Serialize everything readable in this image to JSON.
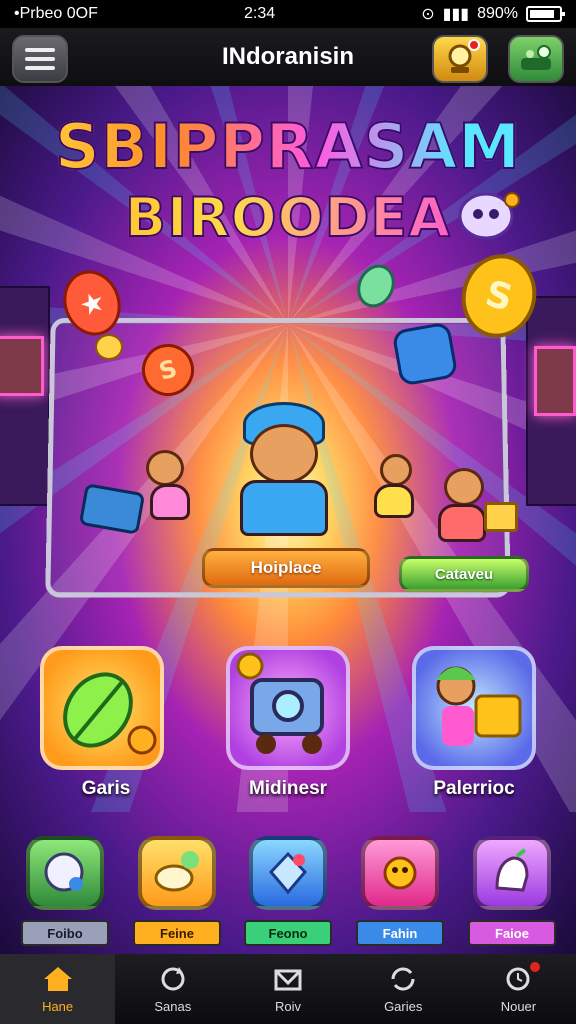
{
  "status_bar": {
    "left": "•Prbeo 0OF",
    "time": "2:34",
    "battery_text": "890%"
  },
  "app_bar": {
    "title": "INdoranisin"
  },
  "logo": {
    "line1": "SBIPPRASAM",
    "line2": "BIROODEA"
  },
  "coins": {
    "red_coin_symbol": "S",
    "gold_coin_symbol": "S"
  },
  "hero_buttons": {
    "primary": "Hoiplace",
    "secondary": "Cataveu"
  },
  "features": [
    {
      "label": "Garis",
      "icon": "leaf-icon"
    },
    {
      "label": "Midinesr",
      "icon": "robot-cart-icon"
    },
    {
      "label": "Palerrioc",
      "icon": "character-box-icon"
    }
  ],
  "quick_actions": [
    {
      "label": "Foibo",
      "icon": "gem-icon",
      "color": "#4cb84a",
      "label_bg": "#9aa0b8"
    },
    {
      "label": "Feine",
      "icon": "shoe-icon",
      "color": "#ffb020",
      "label_bg": "#ffb020"
    },
    {
      "label": "Feono",
      "icon": "crystal-icon",
      "color": "#3aa0e8",
      "label_bg": "#3ad07a"
    },
    {
      "label": "Fahin",
      "icon": "star-creature-icon",
      "color": "#ff4aa8",
      "label_bg": "#3a8ae8"
    },
    {
      "label": "Faioe",
      "icon": "glove-icon",
      "color": "#c860e8",
      "label_bg": "#d85ae0"
    }
  ],
  "bottom_nav": [
    {
      "label": "Hane",
      "icon": "home-icon",
      "active": true
    },
    {
      "label": "Sanas",
      "icon": "refresh-icon",
      "active": false
    },
    {
      "label": "Roiv",
      "icon": "mail-icon",
      "active": false
    },
    {
      "label": "Garies",
      "icon": "sync-icon",
      "active": false
    },
    {
      "label": "Nouer",
      "icon": "clock-icon",
      "active": false
    }
  ]
}
